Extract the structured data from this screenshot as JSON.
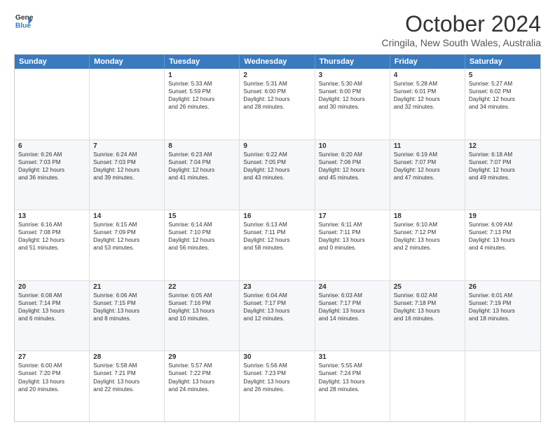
{
  "logo": {
    "line1": "General",
    "line2": "Blue"
  },
  "title": "October 2024",
  "subtitle": "Cringila, New South Wales, Australia",
  "days": [
    "Sunday",
    "Monday",
    "Tuesday",
    "Wednesday",
    "Thursday",
    "Friday",
    "Saturday"
  ],
  "rows": [
    [
      {
        "day": "",
        "lines": []
      },
      {
        "day": "",
        "lines": []
      },
      {
        "day": "1",
        "lines": [
          "Sunrise: 5:33 AM",
          "Sunset: 5:59 PM",
          "Daylight: 12 hours",
          "and 26 minutes."
        ]
      },
      {
        "day": "2",
        "lines": [
          "Sunrise: 5:31 AM",
          "Sunset: 6:00 PM",
          "Daylight: 12 hours",
          "and 28 minutes."
        ]
      },
      {
        "day": "3",
        "lines": [
          "Sunrise: 5:30 AM",
          "Sunset: 6:00 PM",
          "Daylight: 12 hours",
          "and 30 minutes."
        ]
      },
      {
        "day": "4",
        "lines": [
          "Sunrise: 5:28 AM",
          "Sunset: 6:01 PM",
          "Daylight: 12 hours",
          "and 32 minutes."
        ]
      },
      {
        "day": "5",
        "lines": [
          "Sunrise: 5:27 AM",
          "Sunset: 6:02 PM",
          "Daylight: 12 hours",
          "and 34 minutes."
        ]
      }
    ],
    [
      {
        "day": "6",
        "lines": [
          "Sunrise: 6:26 AM",
          "Sunset: 7:03 PM",
          "Daylight: 12 hours",
          "and 36 minutes."
        ]
      },
      {
        "day": "7",
        "lines": [
          "Sunrise: 6:24 AM",
          "Sunset: 7:03 PM",
          "Daylight: 12 hours",
          "and 39 minutes."
        ]
      },
      {
        "day": "8",
        "lines": [
          "Sunrise: 6:23 AM",
          "Sunset: 7:04 PM",
          "Daylight: 12 hours",
          "and 41 minutes."
        ]
      },
      {
        "day": "9",
        "lines": [
          "Sunrise: 6:22 AM",
          "Sunset: 7:05 PM",
          "Daylight: 12 hours",
          "and 43 minutes."
        ]
      },
      {
        "day": "10",
        "lines": [
          "Sunrise: 6:20 AM",
          "Sunset: 7:06 PM",
          "Daylight: 12 hours",
          "and 45 minutes."
        ]
      },
      {
        "day": "11",
        "lines": [
          "Sunrise: 6:19 AM",
          "Sunset: 7:07 PM",
          "Daylight: 12 hours",
          "and 47 minutes."
        ]
      },
      {
        "day": "12",
        "lines": [
          "Sunrise: 6:18 AM",
          "Sunset: 7:07 PM",
          "Daylight: 12 hours",
          "and 49 minutes."
        ]
      }
    ],
    [
      {
        "day": "13",
        "lines": [
          "Sunrise: 6:16 AM",
          "Sunset: 7:08 PM",
          "Daylight: 12 hours",
          "and 51 minutes."
        ]
      },
      {
        "day": "14",
        "lines": [
          "Sunrise: 6:15 AM",
          "Sunset: 7:09 PM",
          "Daylight: 12 hours",
          "and 53 minutes."
        ]
      },
      {
        "day": "15",
        "lines": [
          "Sunrise: 6:14 AM",
          "Sunset: 7:10 PM",
          "Daylight: 12 hours",
          "and 56 minutes."
        ]
      },
      {
        "day": "16",
        "lines": [
          "Sunrise: 6:13 AM",
          "Sunset: 7:11 PM",
          "Daylight: 12 hours",
          "and 58 minutes."
        ]
      },
      {
        "day": "17",
        "lines": [
          "Sunrise: 6:11 AM",
          "Sunset: 7:11 PM",
          "Daylight: 13 hours",
          "and 0 minutes."
        ]
      },
      {
        "day": "18",
        "lines": [
          "Sunrise: 6:10 AM",
          "Sunset: 7:12 PM",
          "Daylight: 13 hours",
          "and 2 minutes."
        ]
      },
      {
        "day": "19",
        "lines": [
          "Sunrise: 6:09 AM",
          "Sunset: 7:13 PM",
          "Daylight: 13 hours",
          "and 4 minutes."
        ]
      }
    ],
    [
      {
        "day": "20",
        "lines": [
          "Sunrise: 6:08 AM",
          "Sunset: 7:14 PM",
          "Daylight: 13 hours",
          "and 6 minutes."
        ]
      },
      {
        "day": "21",
        "lines": [
          "Sunrise: 6:06 AM",
          "Sunset: 7:15 PM",
          "Daylight: 13 hours",
          "and 8 minutes."
        ]
      },
      {
        "day": "22",
        "lines": [
          "Sunrise: 6:05 AM",
          "Sunset: 7:16 PM",
          "Daylight: 13 hours",
          "and 10 minutes."
        ]
      },
      {
        "day": "23",
        "lines": [
          "Sunrise: 6:04 AM",
          "Sunset: 7:17 PM",
          "Daylight: 13 hours",
          "and 12 minutes."
        ]
      },
      {
        "day": "24",
        "lines": [
          "Sunrise: 6:03 AM",
          "Sunset: 7:17 PM",
          "Daylight: 13 hours",
          "and 14 minutes."
        ]
      },
      {
        "day": "25",
        "lines": [
          "Sunrise: 6:02 AM",
          "Sunset: 7:18 PM",
          "Daylight: 13 hours",
          "and 16 minutes."
        ]
      },
      {
        "day": "26",
        "lines": [
          "Sunrise: 6:01 AM",
          "Sunset: 7:19 PM",
          "Daylight: 13 hours",
          "and 18 minutes."
        ]
      }
    ],
    [
      {
        "day": "27",
        "lines": [
          "Sunrise: 6:00 AM",
          "Sunset: 7:20 PM",
          "Daylight: 13 hours",
          "and 20 minutes."
        ]
      },
      {
        "day": "28",
        "lines": [
          "Sunrise: 5:58 AM",
          "Sunset: 7:21 PM",
          "Daylight: 13 hours",
          "and 22 minutes."
        ]
      },
      {
        "day": "29",
        "lines": [
          "Sunrise: 5:57 AM",
          "Sunset: 7:22 PM",
          "Daylight: 13 hours",
          "and 24 minutes."
        ]
      },
      {
        "day": "30",
        "lines": [
          "Sunrise: 5:56 AM",
          "Sunset: 7:23 PM",
          "Daylight: 13 hours",
          "and 26 minutes."
        ]
      },
      {
        "day": "31",
        "lines": [
          "Sunrise: 5:55 AM",
          "Sunset: 7:24 PM",
          "Daylight: 13 hours",
          "and 28 minutes."
        ]
      },
      {
        "day": "",
        "lines": []
      },
      {
        "day": "",
        "lines": []
      }
    ]
  ]
}
